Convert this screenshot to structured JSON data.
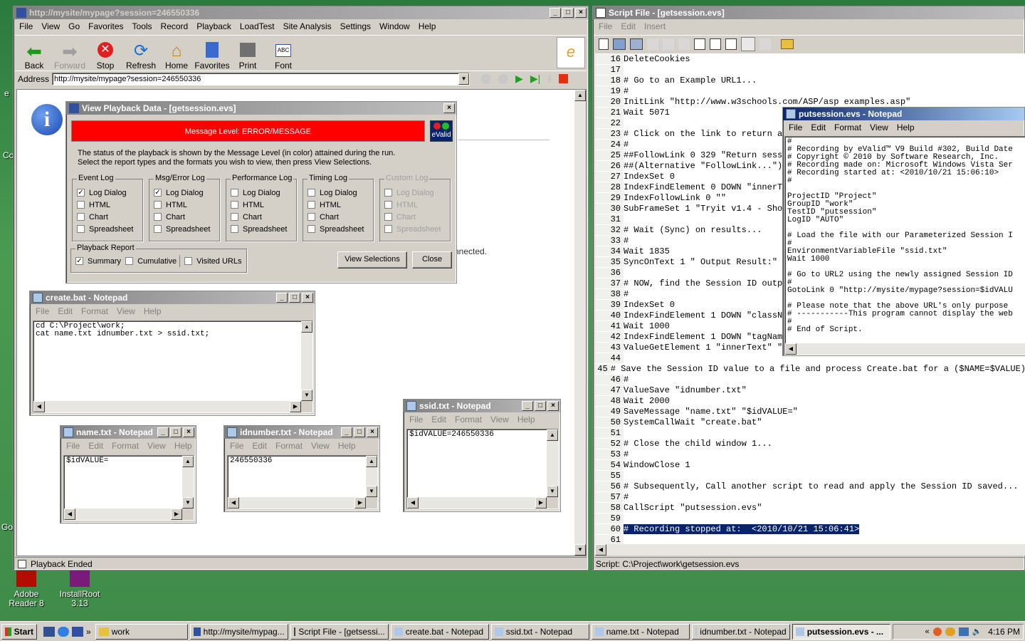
{
  "desktop": {
    "icons": [
      {
        "label": "Adobe Reader 8"
      },
      {
        "label": "InstallRoot 3.13"
      }
    ],
    "left_edge": [
      "e",
      "Cc",
      "Go"
    ]
  },
  "browser": {
    "title": "http://mysite/mypage?session=246550336",
    "menu": [
      "File",
      "View",
      "Go",
      "Favorites",
      "Tools",
      "Record",
      "Playback",
      "LoadTest",
      "Site Analysis",
      "Settings",
      "Window",
      "Help"
    ],
    "toolbar": [
      {
        "label": "Back",
        "icon": "back-arrow-icon"
      },
      {
        "label": "Forward",
        "icon": "forward-arrow-icon"
      },
      {
        "label": "Stop",
        "icon": "stop-icon"
      },
      {
        "label": "Refresh",
        "icon": "refresh-icon"
      },
      {
        "label": "Home",
        "icon": "home-icon"
      },
      {
        "label": "Favorites",
        "icon": "favorites-icon"
      },
      {
        "label": "Print",
        "icon": "print-icon"
      },
      {
        "label": "Font",
        "icon": "font-icon"
      }
    ],
    "address_label": "Address",
    "address": "http://mysite/mypage?session=246550336",
    "page_text": "nnected.",
    "status": "Playback Ended"
  },
  "playback_dialog": {
    "title": "View Playback Data - [getsession.evs]",
    "message_level": "Message Level: ERROR/MESSAGE",
    "badge": "eValid",
    "desc1": "The status of the playback is shown by the Message Level (in color) attained during the run.",
    "desc2": "Select the report types and the formats you wish to view, then press View Selections.",
    "groups": [
      {
        "title": "Event Log",
        "items": [
          {
            "label": "Log Dialog",
            "checked": "✓"
          },
          {
            "label": "HTML",
            "checked": ""
          },
          {
            "label": "Chart",
            "checked": ""
          },
          {
            "label": "Spreadsheet",
            "checked": ""
          }
        ]
      },
      {
        "title": "Msg/Error Log",
        "items": [
          {
            "label": "Log Dialog",
            "checked": "✓"
          },
          {
            "label": "HTML",
            "checked": ""
          },
          {
            "label": "Chart",
            "checked": ""
          },
          {
            "label": "Spreadsheet",
            "checked": ""
          }
        ]
      },
      {
        "title": "Performance Log",
        "items": [
          {
            "label": "Log Dialog",
            "checked": ""
          },
          {
            "label": "HTML",
            "checked": ""
          },
          {
            "label": "Chart",
            "checked": ""
          },
          {
            "label": "Spreadsheet",
            "checked": ""
          }
        ]
      },
      {
        "title": "Timing Log",
        "items": [
          {
            "label": "Log Dialog",
            "checked": ""
          },
          {
            "label": "HTML",
            "checked": ""
          },
          {
            "label": "Chart",
            "checked": ""
          },
          {
            "label": "Spreadsheet",
            "checked": ""
          }
        ]
      },
      {
        "title": "Custom Log",
        "items": [
          {
            "label": "Log Dialog",
            "checked": ""
          },
          {
            "label": "HTML",
            "checked": ""
          },
          {
            "label": "Chart",
            "checked": ""
          },
          {
            "label": "Spreadsheet",
            "checked": ""
          }
        ]
      }
    ],
    "report": {
      "title": "Playback Report",
      "summary": "Summary",
      "summary_checked": "✓",
      "cumulative": "Cumulative",
      "visited": "Visited URLs"
    },
    "view_btn": "View Selections",
    "close_btn": "Close"
  },
  "create_bat": {
    "title": "create.bat - Notepad",
    "menu": [
      "File",
      "Edit",
      "Format",
      "View",
      "Help"
    ],
    "text": "cd C:\\Project\\work;\ncat name.txt idnumber.txt > ssid.txt;"
  },
  "name_txt": {
    "title": "name.txt - Notepad",
    "menu": [
      "File",
      "Edit",
      "Format",
      "View",
      "Help"
    ],
    "text": "$idVALUE="
  },
  "idnumber_txt": {
    "title": "idnumber.txt - Notepad",
    "menu": [
      "File",
      "Edit",
      "Format",
      "View",
      "Help"
    ],
    "text": "246550336"
  },
  "ssid_txt": {
    "title": "ssid.txt - Notepad",
    "menu": [
      "File",
      "Edit",
      "Format",
      "View",
      "Help"
    ],
    "text": "$idVALUE=246550336"
  },
  "script": {
    "title": "Script File - [getsession.evs]",
    "menu": [
      "File",
      "Edit",
      "Insert"
    ],
    "lines": [
      {
        "n": "16",
        "t": "DeleteCookies"
      },
      {
        "n": "17",
        "t": ""
      },
      {
        "n": "18",
        "t": "# Go to an Example URL1..."
      },
      {
        "n": "19",
        "t": "#"
      },
      {
        "n": "20",
        "t": "InitLink \"http://www.w3schools.com/ASP/asp examples.asp\""
      },
      {
        "n": "21",
        "t": "Wait 5071"
      },
      {
        "n": "22",
        "t": ""
      },
      {
        "n": "23",
        "t": "# Click on the link to return a "
      },
      {
        "n": "24",
        "t": "#"
      },
      {
        "n": "25",
        "t": "##FollowLink 0 329 \"Return sessi"
      },
      {
        "n": "26",
        "t": "##(Alternative \"FollowLink...\")"
      },
      {
        "n": "27",
        "t": "IndexSet 0"
      },
      {
        "n": "28",
        "t": "IndexFindElement 0 DOWN \"innerTe"
      },
      {
        "n": "29",
        "t": "IndexFollowLink 0 \"\""
      },
      {
        "n": "30",
        "t": "SubFrameSet 1 \"Tryit v1.4 - Show"
      },
      {
        "n": "31",
        "t": ""
      },
      {
        "n": "32",
        "t": "# Wait (Sync) on results..."
      },
      {
        "n": "33",
        "t": "#"
      },
      {
        "n": "34",
        "t": "Wait 1835"
      },
      {
        "n": "35",
        "t": "SyncOnText 1 \" Output Result:\" "
      },
      {
        "n": "36",
        "t": ""
      },
      {
        "n": "37",
        "t": "# NOW, find the Session ID outpu"
      },
      {
        "n": "38",
        "t": "#"
      },
      {
        "n": "39",
        "t": "IndexSet 0"
      },
      {
        "n": "40",
        "t": "IndexFindElement 1 DOWN \"classNa"
      },
      {
        "n": "41",
        "t": "Wait 1000"
      },
      {
        "n": "42",
        "t": "IndexFindElement 1 DOWN \"tagName"
      },
      {
        "n": "43",
        "t": "ValueGetElement 1 \"innerText\" \"r"
      },
      {
        "n": "44",
        "t": ""
      },
      {
        "n": "45",
        "t": "# Save the Session ID value to a file and process Create.bat for a ($NAME=$VALUE)"
      },
      {
        "n": "46",
        "t": "#"
      },
      {
        "n": "47",
        "t": "ValueSave \"idnumber.txt\""
      },
      {
        "n": "48",
        "t": "Wait 2000"
      },
      {
        "n": "49",
        "t": "SaveMessage \"name.txt\" \"$idVALUE=\""
      },
      {
        "n": "50",
        "t": "SystemCallWait \"create.bat\""
      },
      {
        "n": "51",
        "t": ""
      },
      {
        "n": "52",
        "t": "# Close the child window 1..."
      },
      {
        "n": "53",
        "t": "#"
      },
      {
        "n": "54",
        "t": "WindowClose 1"
      },
      {
        "n": "55",
        "t": ""
      },
      {
        "n": "56",
        "t": "# Subsequently, Call another script to read and apply the Session ID saved..."
      },
      {
        "n": "57",
        "t": "#"
      },
      {
        "n": "58",
        "t": "CallScript \"putsession.evs\""
      },
      {
        "n": "59",
        "t": ""
      },
      {
        "n": "60",
        "t": "# Recording stopped at:  <2010/10/21 15:06:41>"
      },
      {
        "n": "61",
        "t": ""
      }
    ],
    "status": "Script: C:\\Project\\work\\getsession.evs"
  },
  "putsession": {
    "title": "putsession.evs - Notepad",
    "menu": [
      "File",
      "Edit",
      "Format",
      "View",
      "Help"
    ],
    "text": "#\n# Recording by eValid™ V9 Build #302, Build Date\n# Copyright © 2010 by Software Research, Inc.\n# Recording made on: Microsoft Windows Vista Ser\n# Recording started at: <2010/10/21 15:06:10>\n#\n\nProjectID \"Project\"\nGroupID \"work\"\nTestID \"putsession\"\nLogID \"AUTO\"\n\n# Load the file with our Parameterized Session I\n#\nEnvironmentVariableFile \"ssid.txt\"\nWait 1000\n\n# Go to URL2 using the newly assigned Session ID\n#\nGotoLink 0 \"http://mysite/mypage?session=$idVALU\n\n# Please note that the above URL's only purpose\n# -----------This program cannot display the web\n#\n# End of Script."
  },
  "taskbar": {
    "start": "Start",
    "tasks": [
      "work",
      "http://mysite/mypag...",
      "Script File - [getsessi...",
      "create.bat - Notepad",
      "ssid.txt - Notepad",
      "name.txt - Notepad",
      "idnumber.txt - Notepad",
      "putsession.evs - ..."
    ],
    "clock": "4:16 PM"
  }
}
